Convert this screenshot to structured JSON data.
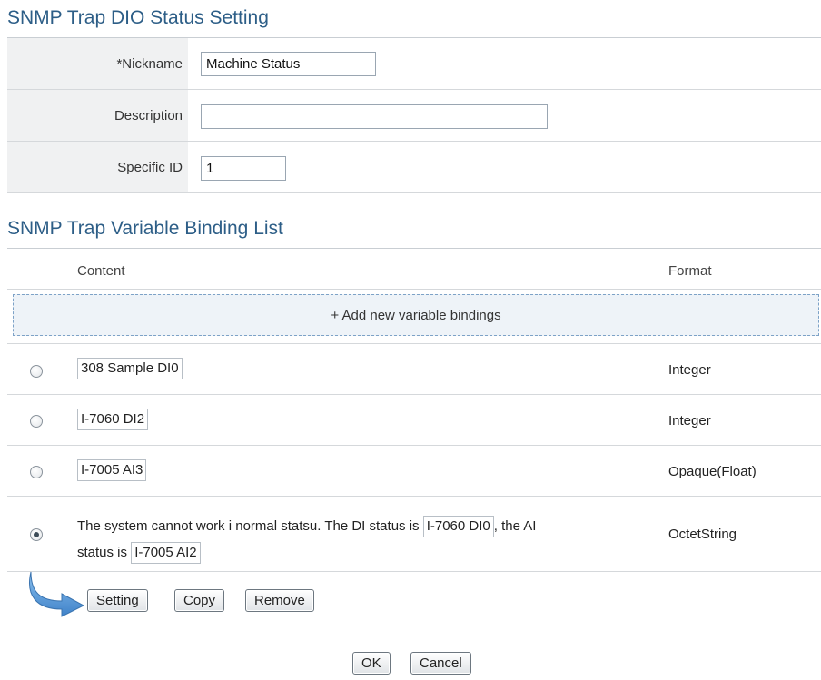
{
  "section1": {
    "title": "SNMP Trap DIO Status Setting"
  },
  "form": {
    "nickname_label": "*Nickname",
    "nickname_value": "Machine Status",
    "description_label": "Description",
    "description_value": "",
    "specific_id_label": "Specific ID",
    "specific_id_value": "1"
  },
  "section2": {
    "title": "SNMP Trap Variable Binding List"
  },
  "table": {
    "col_content": "Content",
    "col_format": "Format",
    "add_label": "+ Add new variable bindings",
    "rows": [
      {
        "content": "308 Sample DI0",
        "format": "Integer",
        "selected": false
      },
      {
        "content": "I-7060 DI2",
        "format": "Integer",
        "selected": false
      },
      {
        "content": "I-7005 AI3",
        "format": "Opaque(Float)",
        "selected": false
      },
      {
        "text_part1": "The system cannot work i normal statsu. The DI status is",
        "var1": "I-7060 DI0",
        "text_part2": ", the AI",
        "text_part3": "status is",
        "var2": "I-7005 AI2",
        "format": "OctetString",
        "selected": true
      }
    ]
  },
  "actions": {
    "setting_label": "Setting",
    "copy_label": "Copy",
    "remove_label": "Remove",
    "arrow_icon": "curved-arrow-icon",
    "arrow_color": "#4a90d9"
  },
  "footer": {
    "ok_label": "OK",
    "cancel_label": "Cancel"
  }
}
